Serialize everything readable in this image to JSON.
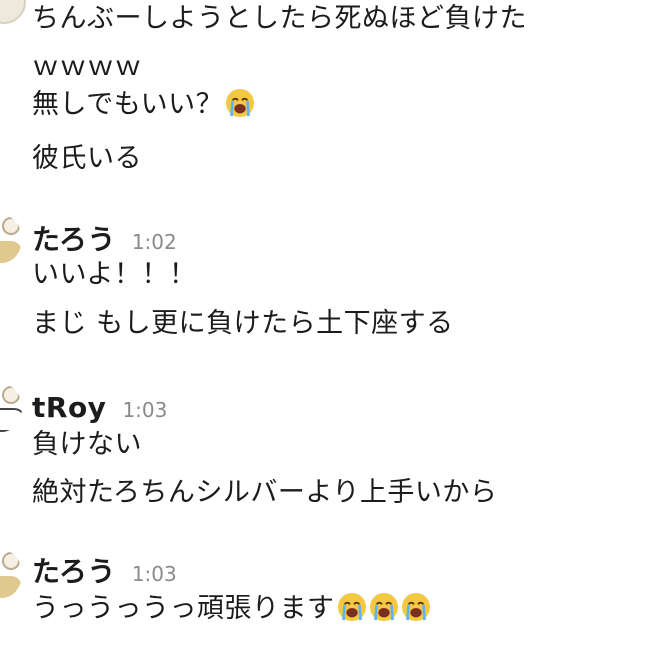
{
  "messages": [
    {
      "lines": [
        {
          "text": "ちんぶーしようとしたら死ぬほど負けた"
        },
        {
          "text": "ｗｗｗｗ"
        },
        {
          "text": "無しでもいい？",
          "emoji_count": 1
        },
        {
          "text": "彼氏いる"
        }
      ]
    },
    {
      "username": "たろう",
      "time": "1:02",
      "lines": [
        {
          "text": "いいよ！！！"
        },
        {
          "text": "まじ もし更に負けたら土下座する"
        }
      ]
    },
    {
      "username": "tRoy",
      "time": "1:03",
      "lines": [
        {
          "text": "負けない"
        },
        {
          "text": "絶対たろちんシルバーより上手いから"
        }
      ]
    },
    {
      "username": "たろう",
      "time": "1:03",
      "lines": [
        {
          "text": "うっうっうっ頑張ります",
          "emoji_count": 3
        }
      ]
    }
  ],
  "emoji": {
    "name": "loudly-crying-face-icon",
    "color": "#f5c842"
  },
  "colors": {
    "text": "#1d1c1d",
    "timestamp": "#8a8a8a",
    "background": "#ffffff"
  }
}
